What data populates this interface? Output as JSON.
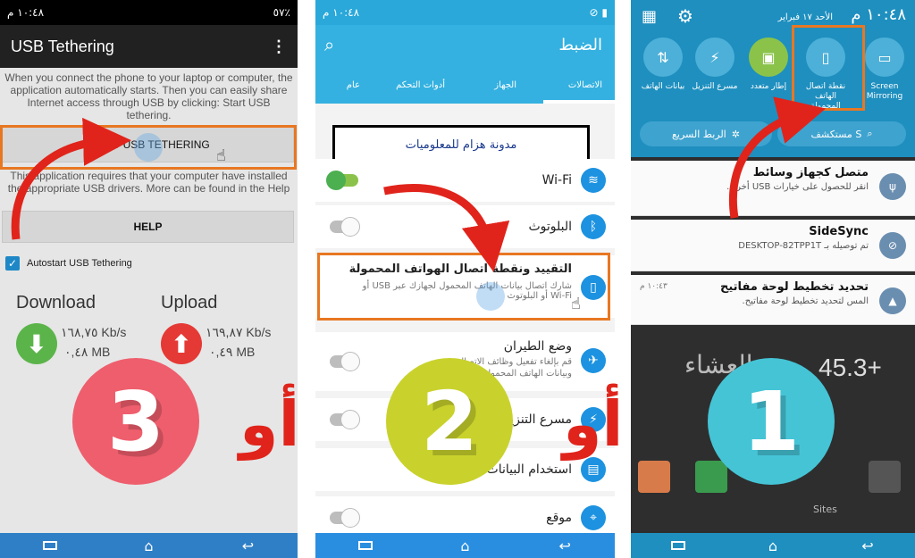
{
  "phone1": {
    "status_time": "١٠:٤٨ م",
    "status_battery": "٥٧٪",
    "app_title": "USB Tethering",
    "menu_icon": "more-vert-icon",
    "intro_text": "When you connect the phone to your laptop or computer, the application automatically starts. Then you can easily share Internet access through USB by clicking: Start USB tethering.",
    "start_button": "START USB TETHERING",
    "requirement_text": "This application requires that your computer have installed the appropriate USB drivers. More can be found in the Help",
    "help_button": "HELP",
    "autostart_label": "Autostart USB Tethering",
    "download_label": "Download",
    "upload_label": "Upload",
    "download_speed": "١٦٨,٧٥ Kb/s",
    "download_total": "٠,٤٨ MB",
    "upload_speed": "١٦٩,٨٧ Kb/s",
    "upload_total": "٠,٤٩ MB"
  },
  "phone2": {
    "status_time": "١٠:٤٨ م",
    "header_title": "الضبط",
    "tabs": [
      "الاتصالات",
      "الجهاز",
      "أدوات التحكم",
      "عام"
    ],
    "watermark_label": "مدونة هزام للمعلوميات",
    "rows": [
      {
        "title": "Wi-Fi",
        "toggle": "on"
      },
      {
        "title": "البلوتوث",
        "toggle": "off"
      },
      {
        "title": "التقييد ونقطة اتصال الهواتف المحمولة",
        "subtitle": "شارك اتصال بيانات الهاتف المحمول لجهازك عبر USB أو Wi-Fi أو البلوتوث"
      },
      {
        "title": "وضع الطيران",
        "subtitle": "قم بإلغاء تفعيل وظائف الاتصال",
        "subtitle2": "وبيانات الهاتف المحمول",
        "toggle": "off"
      },
      {
        "title": "مسرع التنزيل",
        "toggle": "off"
      },
      {
        "title": "استخدام البيانات"
      },
      {
        "title": "موقع",
        "toggle": "off"
      }
    ]
  },
  "phone3": {
    "status_time": "١٠:٤٨ م",
    "date_label": "الأحد ١٧ فبراير",
    "quick_settings": [
      {
        "label": "Screen Mirroring",
        "icon": "screen-mirroring-icon"
      },
      {
        "label": "نقطة اتصال الهاتف المحمولة",
        "icon": "hotspot-icon"
      },
      {
        "label": "إطار متعدد",
        "icon": "multi-window-icon"
      },
      {
        "label": "مسرع التنزيل",
        "icon": "download-booster-icon"
      },
      {
        "label": "بيانات الهاتف",
        "icon": "mobile-data-icon"
      }
    ],
    "quick_connect": "الربط السريع",
    "s_finder": "مستكشف S",
    "notifications": [
      {
        "title": "متصل كجهاز وسائط",
        "subtitle": "انقر للحصول على خيارات USB أخرى.",
        "icon": "usb-icon"
      },
      {
        "title": "SideSync",
        "subtitle": "تم توصيله بـ DESKTOP-82TPP1T",
        "icon": "sidesync-icon"
      },
      {
        "title": "تحديد تخطيط لوحة مفاتيح",
        "subtitle": "المس لتحديد تخطيط لوحة مفاتيح.",
        "time": "١٠:٤٣ م",
        "icon": "keyboard-icon"
      }
    ],
    "weather_temp": "45.3+",
    "background_label": "العشاء",
    "sites_label": "Sites"
  },
  "badges": {
    "one": "1",
    "two": "2",
    "three": "3"
  },
  "or_label": "أو",
  "colors": {
    "badge1": "#45c4d6",
    "badge2": "#c9d22c",
    "badge3": "#ef5e6d",
    "highlight": "#e87722",
    "arrow": "#e0241b"
  }
}
